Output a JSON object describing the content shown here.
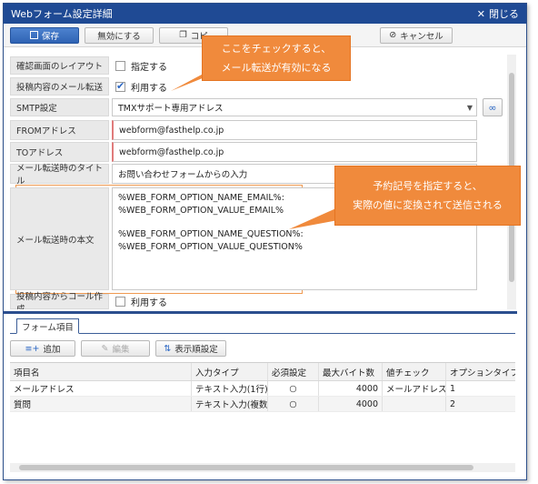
{
  "window": {
    "title": "Webフォーム設定詳細",
    "close_label": "閉じる"
  },
  "toolbar": {
    "save": "保存",
    "disable": "無効にする",
    "copy": "コピ",
    "cancel": "キャンセル"
  },
  "fields": {
    "confirm_layout": {
      "label": "確認画面のレイアウト",
      "check_label": "指定する"
    },
    "mail_forward": {
      "label": "投稿内容のメール転送",
      "check_label": "利用する",
      "checked": true
    },
    "smtp": {
      "label": "SMTP設定",
      "value": "TMXサポート専用アドレス"
    },
    "from": {
      "label": "FROMアドレス",
      "value": "webform@fasthelp.co.jp"
    },
    "to": {
      "label": "TOアドレス",
      "value": "webform@fasthelp.co.jp"
    },
    "subject": {
      "label": "メール転送時のタイトル",
      "value": "お問い合わせフォームからの入力"
    },
    "body": {
      "label": "メール転送時の本文",
      "lines": [
        "%WEB_FORM_OPTION_NAME_EMAIL%:",
        "%WEB_FORM_OPTION_VALUE_EMAIL%",
        "",
        "%WEB_FORM_OPTION_NAME_QUESTION%:",
        "%WEB_FORM_OPTION_VALUE_QUESTION%"
      ]
    },
    "call_create": {
      "label": "投稿内容からコール作成",
      "check_label": "利用する"
    }
  },
  "callouts": {
    "first": [
      "ここをチェックすると、",
      "メール転送が有効になる"
    ],
    "second": [
      "予約記号を指定すると、",
      "実際の値に変換されて送信される"
    ]
  },
  "tabs": {
    "form_items": "フォーム項目"
  },
  "item_toolbar": {
    "add": "追加",
    "edit": "編集",
    "order": "表示順設定"
  },
  "grid": {
    "columns": [
      "項目名",
      "入力タイプ",
      "必須設定",
      "最大バイト数",
      "値チェック",
      "オプションタイプ"
    ],
    "rows": [
      [
        "メールアドレス",
        "テキスト入力(1行)",
        "○",
        "4000",
        "メールアドレス",
        "1"
      ],
      [
        "質問",
        "テキスト入力(複数行)",
        "○",
        "4000",
        "",
        "2"
      ]
    ]
  },
  "colors": {
    "title_bar": "#1f4a94",
    "accent": "#f08a3c",
    "required_border": "#e07b7b"
  }
}
